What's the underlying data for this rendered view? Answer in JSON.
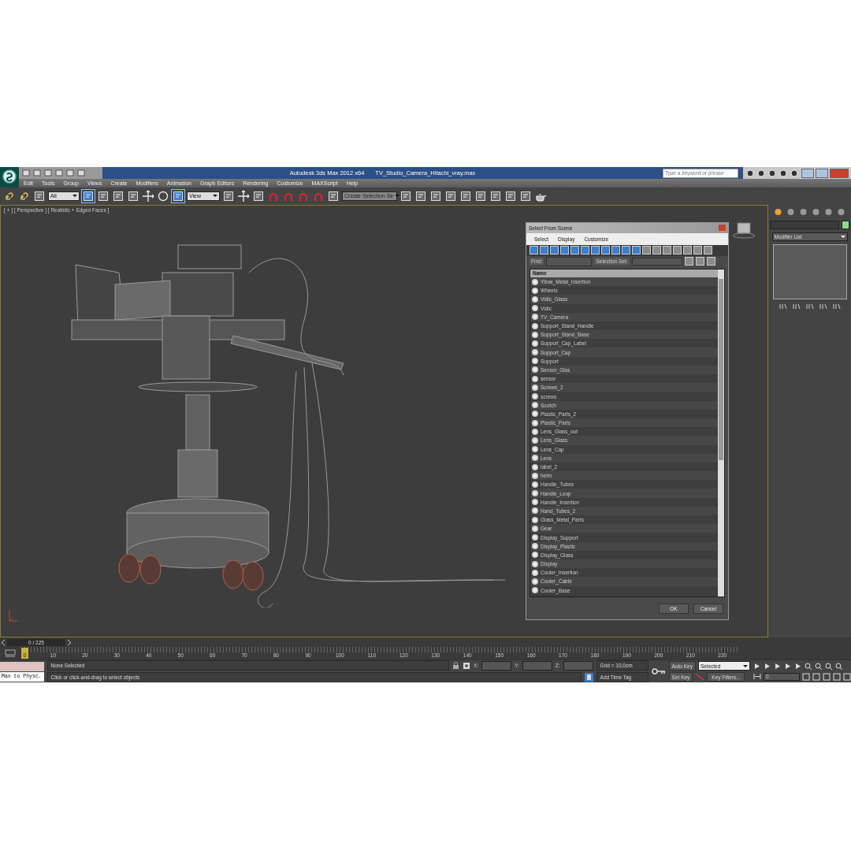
{
  "title_bar": {
    "app": "Autodesk 3ds Max  2012 x64",
    "file": "TV_Studio_Camera_Hitachi_vray.max",
    "search": {
      "placeholder": "Type a keyword or phrase"
    }
  },
  "menu": [
    "Edit",
    "Tools",
    "Group",
    "Views",
    "Create",
    "Modifiers",
    "Animation",
    "Graph Editors",
    "Rendering",
    "Customize",
    "MAXScript",
    "Help"
  ],
  "toolbar": {
    "filter": "All",
    "ref_coord": "View",
    "selection_set": {
      "placeholder": "Create Selection Se"
    }
  },
  "viewport": {
    "label": "[ + ] [ Perspective ] [ Realistic + Edged Faces ]"
  },
  "dialog": {
    "title": "Select From Scene",
    "menu": [
      "Select",
      "Display",
      "Customize"
    ],
    "find_label": "Find:",
    "selection_set_label": "Selection Set:",
    "column": "Name",
    "items": [
      "Yllow_Metal_Insertion",
      "Wheels",
      "Vidic_Glass",
      "Vidic",
      "TV_Camera",
      "Support_Stand_Handle",
      "Support_Stand_Base",
      "Support_Cap_Label",
      "Support_Cap",
      "Support",
      "Sensor_Glss",
      "sensor",
      "Screws_2",
      "screws",
      "Scotch",
      "Plastic_Parts_2",
      "Plastic_Parts",
      "Lens_Glass_out",
      "Lens_Glass",
      "Lens_Cap",
      "Lens",
      "label_2",
      "helm",
      "Handle_Tubes",
      "Handle_Loop",
      "Handle_Insertion",
      "Hand_Tubes_2",
      "Glass_Metal_Parts",
      "Gear",
      "Display_Support",
      "Display_Plastic",
      "Display_Glass",
      "Display",
      "Cooler_Insertion",
      "Cooler_Cable",
      "Cooler_Base"
    ],
    "buttons": [
      "OK",
      "Cancel"
    ]
  },
  "command_panel": {
    "modifier_list": "Modifier List"
  },
  "time_slider": {
    "position": "0 / 225",
    "ticks": [
      "10",
      "20",
      "30",
      "40",
      "50",
      "60",
      "70",
      "80",
      "90",
      "100",
      "110",
      "120",
      "130",
      "140",
      "150",
      "160",
      "170",
      "180",
      "190",
      "200",
      "210",
      "220"
    ],
    "current": "0"
  },
  "status": {
    "script_listener": "Max to Physc.",
    "selection": "None Selected",
    "prompt": "Click or click-and-drag to select objects",
    "x_label": "X:",
    "y_label": "Y:",
    "z_label": "Z:",
    "grid": "Grid = 10,0cm",
    "add_time_tag": "Add Time Tag",
    "auto_key": "Auto Key",
    "set_key": "Set Key",
    "key_mode": "Selected",
    "key_filters": "Key Filters...",
    "frame": "0"
  }
}
